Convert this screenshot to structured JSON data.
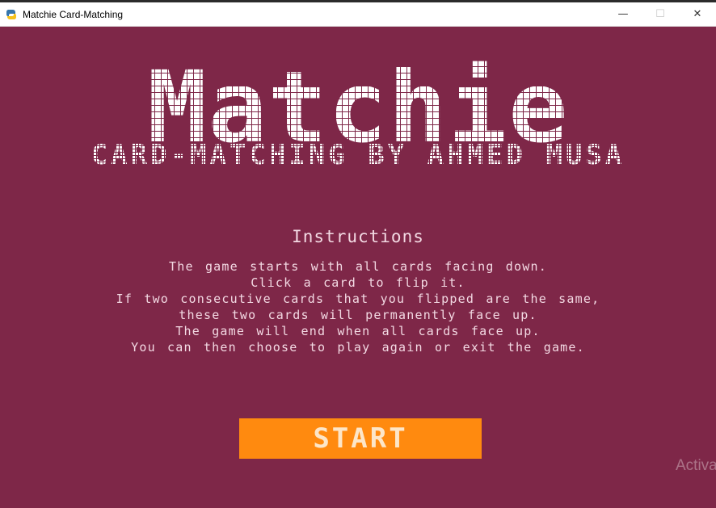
{
  "window": {
    "title": "Matchie Card-Matching",
    "minimize_label": "—",
    "maximize_label": "☐",
    "close_label": "✕"
  },
  "game": {
    "title": "Matchie",
    "subtitle": "CARD-MATCHING BY AHMED MUSA",
    "instructions_heading": "Instructions",
    "instructions": [
      "The game starts with all cards facing down.",
      "Click a card to flip it.",
      "If two consecutive cards that you flipped are the same,",
      "these two cards will permanently face up.",
      "The game will end when all cards face up.",
      "You can then choose to play again or exit the game."
    ],
    "start_label": "START"
  },
  "overlay": {
    "watermark_text": "Activa"
  },
  "colors": {
    "background": "#7e2748",
    "title_text": "#ffffff",
    "body_text": "#f3d9e3",
    "start_button": "#ff8a0f",
    "start_text": "#fde6c8"
  }
}
